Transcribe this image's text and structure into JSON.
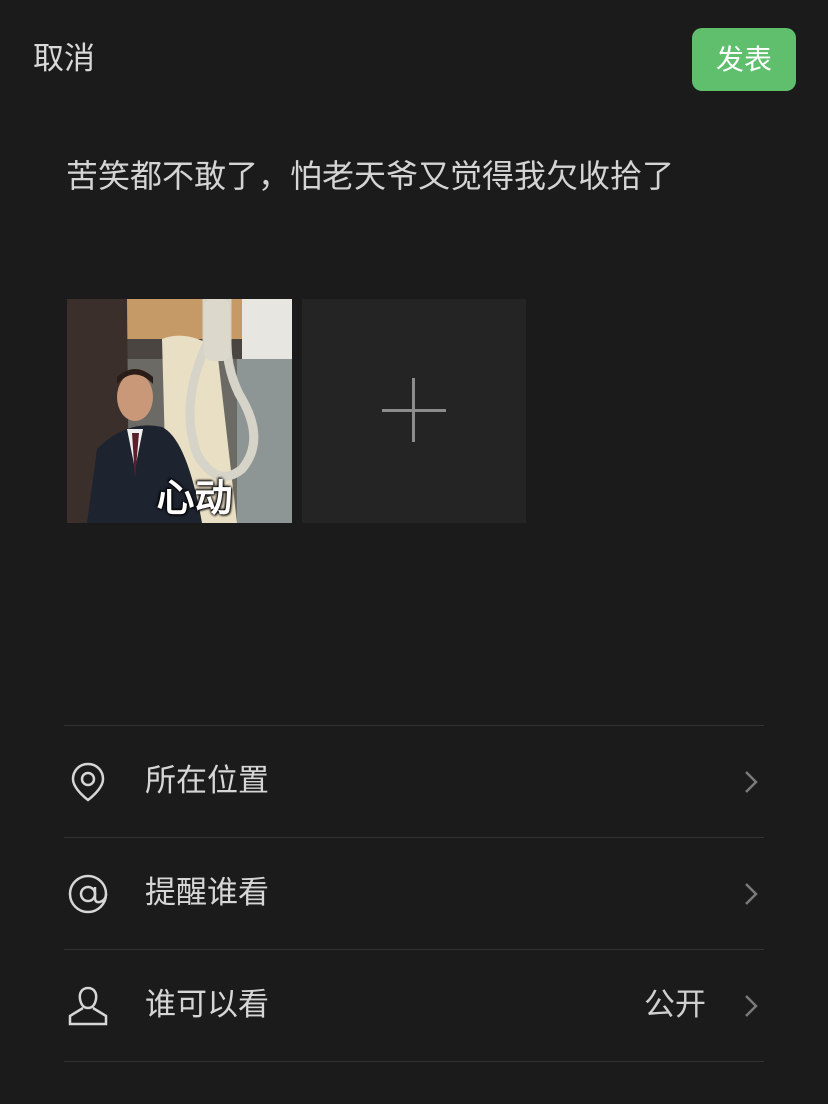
{
  "header": {
    "cancel_label": "取消",
    "publish_label": "发表"
  },
  "post": {
    "text": "苦笑都不敢了，怕老天爷又觉得我欠收拾了"
  },
  "attachments": {
    "image_caption": "心动"
  },
  "options": {
    "location": {
      "icon": "location-pin-icon",
      "label": "所在位置"
    },
    "remind": {
      "icon": "at-sign-icon",
      "label": "提醒谁看"
    },
    "visibility": {
      "icon": "person-icon",
      "label": "谁可以看",
      "value": "公开"
    }
  },
  "colors": {
    "background": "#1b1b1b",
    "accent": "#5fbf6d",
    "add_tile": "#242424"
  }
}
